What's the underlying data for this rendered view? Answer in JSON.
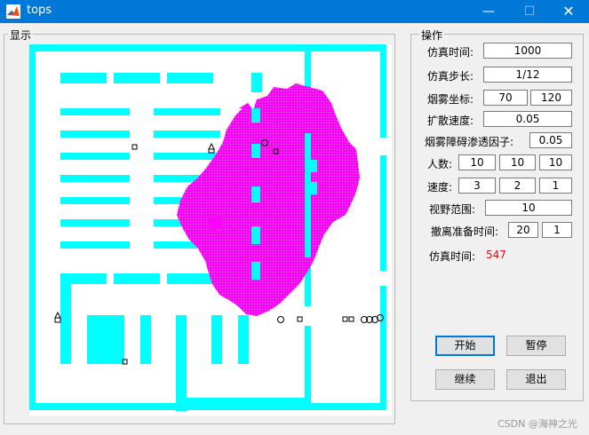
{
  "window": {
    "title": "tops",
    "minimize": "—",
    "maximize": "☐",
    "close": "✕",
    "icon": "matlab-icon"
  },
  "display_panel": {
    "title": "显示"
  },
  "ops_panel": {
    "title": "操作",
    "sim_time_label": "仿真时间:",
    "sim_time_value": "1000",
    "sim_step_label": "仿真步长:",
    "sim_step_value": "1/12",
    "smoke_coord_label": "烟雾坐标:",
    "smoke_x": "70",
    "smoke_y": "120",
    "spread_speed_label": "扩散速度:",
    "spread_speed_value": "0.05",
    "penetration_label": "烟雾障碍渗透因子:",
    "penetration_value": "0.05",
    "people_label": "人数:",
    "people_values": [
      "10",
      "10",
      "10"
    ],
    "speed_label": "速度:",
    "speed_values": [
      "3",
      "2",
      "1"
    ],
    "vision_label": "视野范围:",
    "vision_value": "10",
    "evac_prep_label": "撤离准备时间:",
    "evac_prep_values": [
      "20",
      "1"
    ],
    "elapsed_label": "仿真时间:",
    "elapsed_value": "547",
    "start_button": "开始",
    "pause_button": "暂停",
    "continue_button": "继续",
    "exit_button": "退出"
  },
  "colors": {
    "wall": "#00ffff",
    "smoke": "#ff00ff",
    "title_bar": "#0078d7",
    "elapsed_value": "#d01010"
  },
  "watermark": "CSDN @海神之光"
}
